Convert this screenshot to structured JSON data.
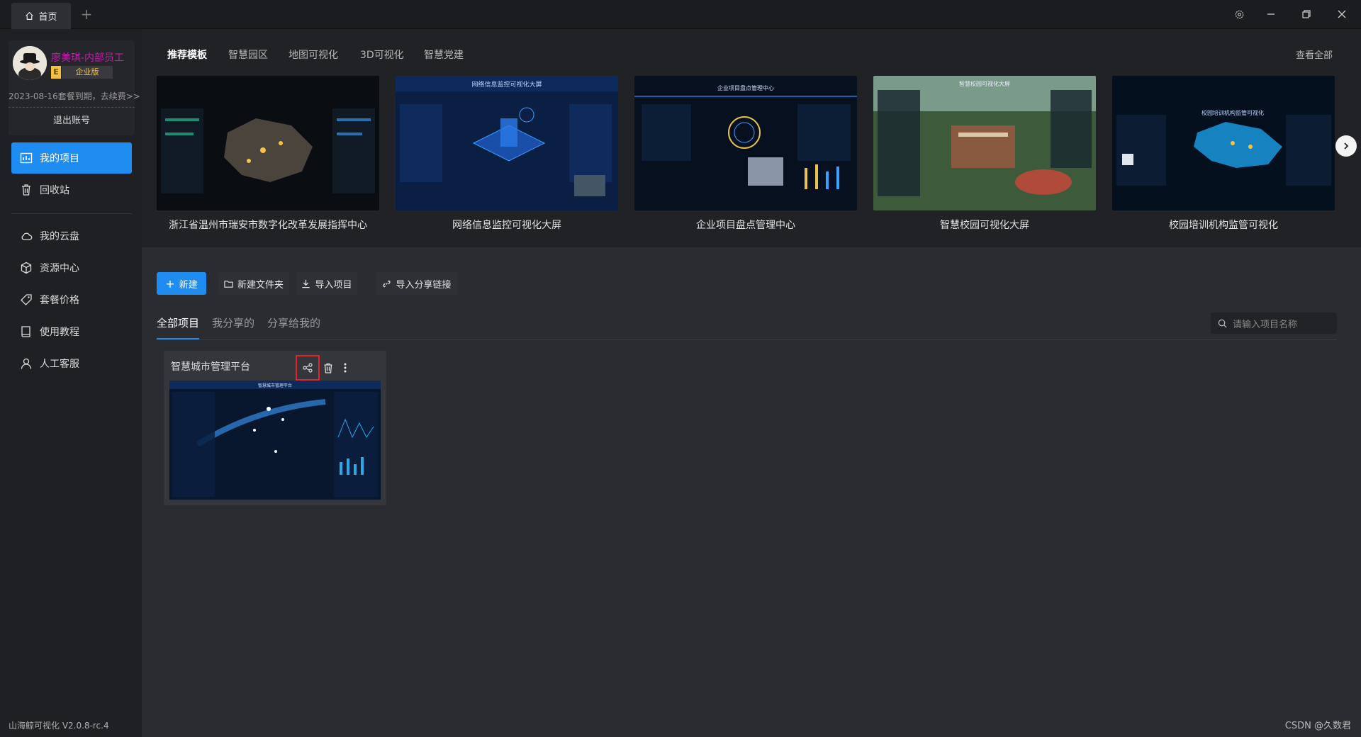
{
  "titlebar": {
    "home_tab_label": "首页",
    "add_tab_symbol": "+"
  },
  "sidebar": {
    "user": {
      "name": "廖美琪-内部员工",
      "badge_letter": "E",
      "badge_label": "企业版",
      "expire_text": "2023-08-16套餐到期，去续费>>",
      "logout_label": "退出账号"
    },
    "nav_primary": [
      {
        "label": "我的项目",
        "icon": "chart-icon",
        "active": true
      },
      {
        "label": "回收站",
        "icon": "trash-icon",
        "active": false
      }
    ],
    "nav_secondary": [
      {
        "label": "我的云盘",
        "icon": "cloud-icon"
      },
      {
        "label": "资源中心",
        "icon": "cube-icon"
      },
      {
        "label": "套餐价格",
        "icon": "tag-icon"
      },
      {
        "label": "使用教程",
        "icon": "book-icon"
      },
      {
        "label": "人工客服",
        "icon": "user-icon"
      }
    ],
    "version": "山海鲸可视化 V2.0.8-rc.4"
  },
  "templates": {
    "tabs": [
      "推荐模板",
      "智慧园区",
      "地图可视化",
      "3D可视化",
      "智慧党建"
    ],
    "view_all_label": "查看全部",
    "items": [
      {
        "title": "浙江省温州市瑞安市数字化改革发展指挥中心"
      },
      {
        "title": "网络信息监控可视化大屏",
        "thumb_heading": "网络信息监控可视化大屏"
      },
      {
        "title": "企业项目盘点管理中心",
        "thumb_heading": "企业项目盘点管理中心"
      },
      {
        "title": "智慧校园可视化大屏",
        "thumb_heading": "智慧校园可视化大屏"
      },
      {
        "title": "校园培训机构监管可视化",
        "thumb_heading": "校园培训机构监管可视化"
      }
    ]
  },
  "toolbar": {
    "new_label": "新建",
    "new_folder_label": "新建文件夹",
    "import_project_label": "导入项目",
    "import_link_label": "导入分享链接"
  },
  "project_tabs": {
    "all": "全部项目",
    "shared_by_me": "我分享的",
    "shared_to_me": "分享给我的"
  },
  "search": {
    "placeholder": "请输入项目名称"
  },
  "projects": [
    {
      "title": "智慧城市管理平台",
      "thumb_heading": "智慧城市管理平台"
    }
  ],
  "watermark": "CSDN @久数君",
  "colors": {
    "accent": "#1e8cf0",
    "user_name": "#c21fa8",
    "badge": "#f3c23c",
    "highlight_box": "#e0262a"
  }
}
